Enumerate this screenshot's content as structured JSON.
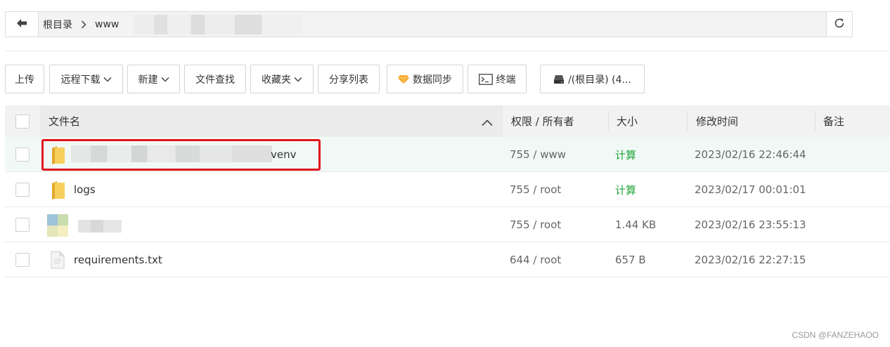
{
  "pathbar": {
    "crumbs": [
      "根目录",
      "www"
    ]
  },
  "toolbar": {
    "upload": "上传",
    "remote_download": "远程下载",
    "new": "新建",
    "file_search": "文件查找",
    "favorites": "收藏夹",
    "share_list": "分享列表",
    "data_sync": "数据同步",
    "terminal": "终端",
    "disk": "/(根目录) (4..."
  },
  "table": {
    "headers": {
      "name": "文件名",
      "perm": "权限 / 所有者",
      "size": "大小",
      "mtime": "修改时间",
      "note": "备注"
    },
    "rows": [
      {
        "name": "venv",
        "type": "folder",
        "perm": "755 / www",
        "size": "计算",
        "mtime": "2023/02/16 22:46:44"
      },
      {
        "name": "logs",
        "type": "folder",
        "perm": "755 / root",
        "size": "计算",
        "mtime": "2023/02/17 00:01:01"
      },
      {
        "name": "",
        "type": "image",
        "perm": "755 / root",
        "size": "1.44 KB",
        "mtime": "2023/02/16 23:55:13"
      },
      {
        "name": "requirements.txt",
        "type": "file",
        "perm": "644 / root",
        "size": "657 B",
        "mtime": "2023/02/16 22:27:15"
      }
    ]
  },
  "colors": {
    "accent_green": "#20a53a",
    "highlight_red": "#e0141e",
    "folder_yellow": "#f5c542"
  },
  "watermark": "CSDN @FANZEHAOO"
}
